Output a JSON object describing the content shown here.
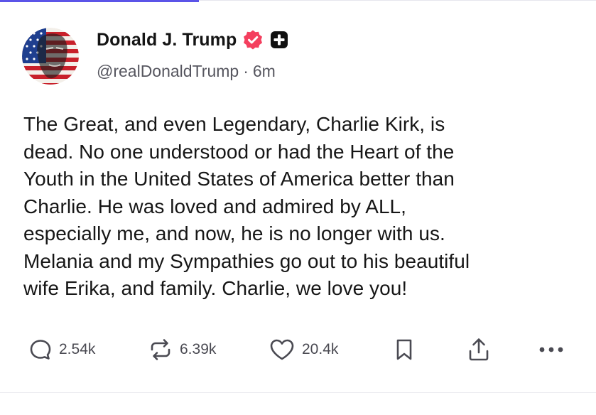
{
  "post": {
    "author": {
      "display_name": "Donald J. Trump",
      "handle": "@realDonaldTrump",
      "separator": "·",
      "time_ago": "6m",
      "verified_icon": "verified-badge-icon",
      "subscription_icon": "plus-badge-icon",
      "verified_color": "#f43f5e"
    },
    "body": "The Great, and even Legendary, Charlie Kirk, is\ndead. No one understood or had the Heart of the\nYouth in the United States of America better than\nCharlie. He was loved and admired by ALL,\nespecially me, and now, he is no longer with us.\nMelania and my Sympathies go out to his beautiful\nwife Erika, and family. Charlie, we love you!",
    "actions": {
      "replies": {
        "icon": "reply-bubble-icon",
        "count": "2.54k"
      },
      "reposts": {
        "icon": "repost-icon",
        "count": "6.39k"
      },
      "likes": {
        "icon": "heart-icon",
        "count": "20.4k"
      },
      "bookmark": {
        "icon": "bookmark-icon"
      },
      "share": {
        "icon": "share-icon"
      },
      "more": {
        "icon": "more-options-icon"
      }
    }
  },
  "colors": {
    "accent": "#5b54e8",
    "text_primary": "#161616",
    "text_secondary": "#56565f",
    "icon_gray": "#4a4a52"
  }
}
